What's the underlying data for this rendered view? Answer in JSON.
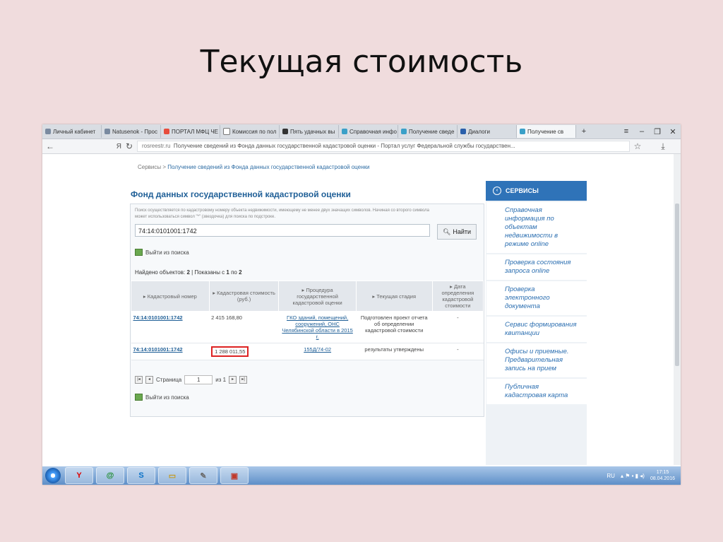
{
  "slide": {
    "title": "Текущая стоимость"
  },
  "browser": {
    "tabs": [
      {
        "label": "Личный кабинет"
      },
      {
        "label": "Natusenok - Прос"
      },
      {
        "label": "ПОРТАЛ МФЦ ЧЕ"
      },
      {
        "label": "Комиссия по пол"
      },
      {
        "label": "Пять удачных вы"
      },
      {
        "label": "Справочная инфо"
      },
      {
        "label": "Получение сведе"
      },
      {
        "label": "Диалоги"
      },
      {
        "label": "Получение св"
      }
    ],
    "address": {
      "domain": "rosreestr.ru",
      "title": "Получение сведений из Фонда данных государственной кадастровой оценки - Портал услуг Федеральной службы государствен..."
    }
  },
  "page": {
    "breadcrumb": {
      "root": "Сервисы",
      "sep": ">",
      "current": "Получение сведений из Фонда данных государственной кадастровой оценки"
    },
    "heading": "Фонд данных государственной кадастровой оценки",
    "hint": "Поиск осуществляется по кадастровому номеру объекта недвижимости, имеющему не менее двух значащих символов. Начиная со второго символа может использоваться символ \"*\" (звездочка) для поиска по подстроке.",
    "search": {
      "value": "74:14:0101001:1742",
      "button": "Найти"
    },
    "exit_label": "Выйти из поиска",
    "found": {
      "prefix": "Найдено объектов:",
      "count": "2",
      "mid": "| Показаны с",
      "from": "1",
      "to_word": "по",
      "to": "2"
    },
    "table": {
      "headers": [
        "Кадастровый номер",
        "Кадастровая стоимость (руб.)",
        "Процедура государственной кадастровой оценки",
        "Текущая стадия",
        "Дата определения кадастровой стоимости"
      ],
      "rows": [
        {
          "number": "74:14:0101001:1742",
          "cost": "2 415 168,80",
          "procedure": "ГКО зданий, помещений, сооружений, ОНС Челябинской области в 2015 г.",
          "stage": "Подготовлен проект отчета об определении кадастровой стоимости",
          "date": "-"
        },
        {
          "number": "74:14:0101001:1742",
          "cost": "1 288 011,55",
          "procedure": "155Д/74-02",
          "stage": "результаты утверждены",
          "date": "-"
        }
      ]
    },
    "pager": {
      "label": "Страница",
      "value": "1",
      "of": "из 1"
    }
  },
  "side": {
    "header": "СЕРВИСЫ",
    "items": [
      {
        "label": "Справочная информация по объектам недвижимости в режиме online"
      },
      {
        "label": "Проверка состояния запроса online"
      },
      {
        "label": "Проверка электронного документа"
      },
      {
        "label": "Сервис формирования квитанции"
      },
      {
        "label": "Офисы и приемные. Предварительная запись на прием"
      },
      {
        "label": "Публичная кадастровая карта"
      }
    ]
  },
  "taskbar": {
    "lang": "RU",
    "time": "17:15",
    "date": "08.04.2016"
  }
}
